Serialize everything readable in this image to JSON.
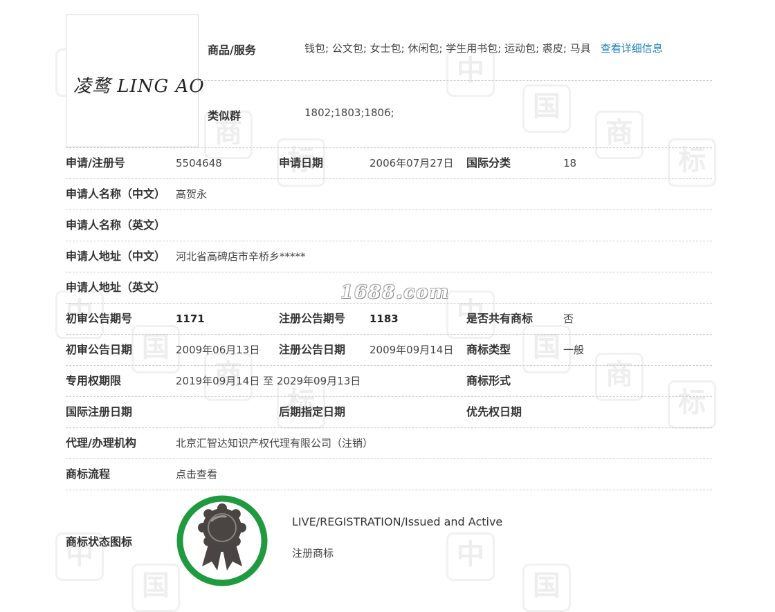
{
  "logo": {
    "text": "凌鹜 LING AO"
  },
  "goods": {
    "label": "商品/服务",
    "value": "钱包; 公文包; 女士包; 休闲包; 学生用书包; 运动包; 裘皮; 马具",
    "detail_link": "查看详细信息"
  },
  "similar_group": {
    "label": "类似群",
    "value": "1802;1803;1806;"
  },
  "rows": {
    "reg_no_label": "申请/注册号",
    "reg_no": "5504648",
    "apply_date_label": "申请日期",
    "apply_date": "2006年07月27日",
    "intl_class_label": "国际分类",
    "intl_class": "18",
    "applicant_cn_label": "申请人名称（中文）",
    "applicant_cn": "高贺永",
    "applicant_en_label": "申请人名称（英文）",
    "applicant_en": "",
    "address_cn_label": "申请人地址（中文）",
    "address_cn": "河北省高碑店市辛桥乡*****",
    "address_en_label": "申请人地址（英文）",
    "address_en": "",
    "prelim_issue_label": "初审公告期号",
    "prelim_issue": "1171",
    "reg_issue_label": "注册公告期号",
    "reg_issue": "1183",
    "shared_label": "是否共有商标",
    "shared": "否",
    "prelim_date_label": "初审公告日期",
    "prelim_date": "2009年06月13日",
    "reg_date_label": "注册公告日期",
    "reg_date": "2009年09月14日",
    "tm_type_label": "商标类型",
    "tm_type": "一般",
    "exclusive_label": "专用权期限",
    "exclusive": "2019年09月14日 至 2029年09月13日",
    "tm_form_label": "商标形式",
    "tm_form": "",
    "intl_reg_date_label": "国际注册日期",
    "later_designation_label": "后期指定日期",
    "priority_date_label": "优先权日期",
    "agent_label": "代理/办理机构",
    "agent": "北京汇智达知识产权代理有限公司（注销）",
    "process_label": "商标流程",
    "process_link": "点击查看"
  },
  "status": {
    "label": "商标状态图标",
    "en": "LIVE/REGISTRATION/Issued and Active",
    "cn": "注册商标",
    "icon": "registered-ribbon-badge-icon",
    "ring_color": "#1f9a3e",
    "medal_color": "#4a4442"
  },
  "watermark": {
    "site": "1688.com",
    "glyphs": [
      "中",
      "国",
      "商",
      "标"
    ]
  },
  "colors": {
    "link": "#1a80bf",
    "divider": "#cccccc",
    "label": "#333333"
  }
}
